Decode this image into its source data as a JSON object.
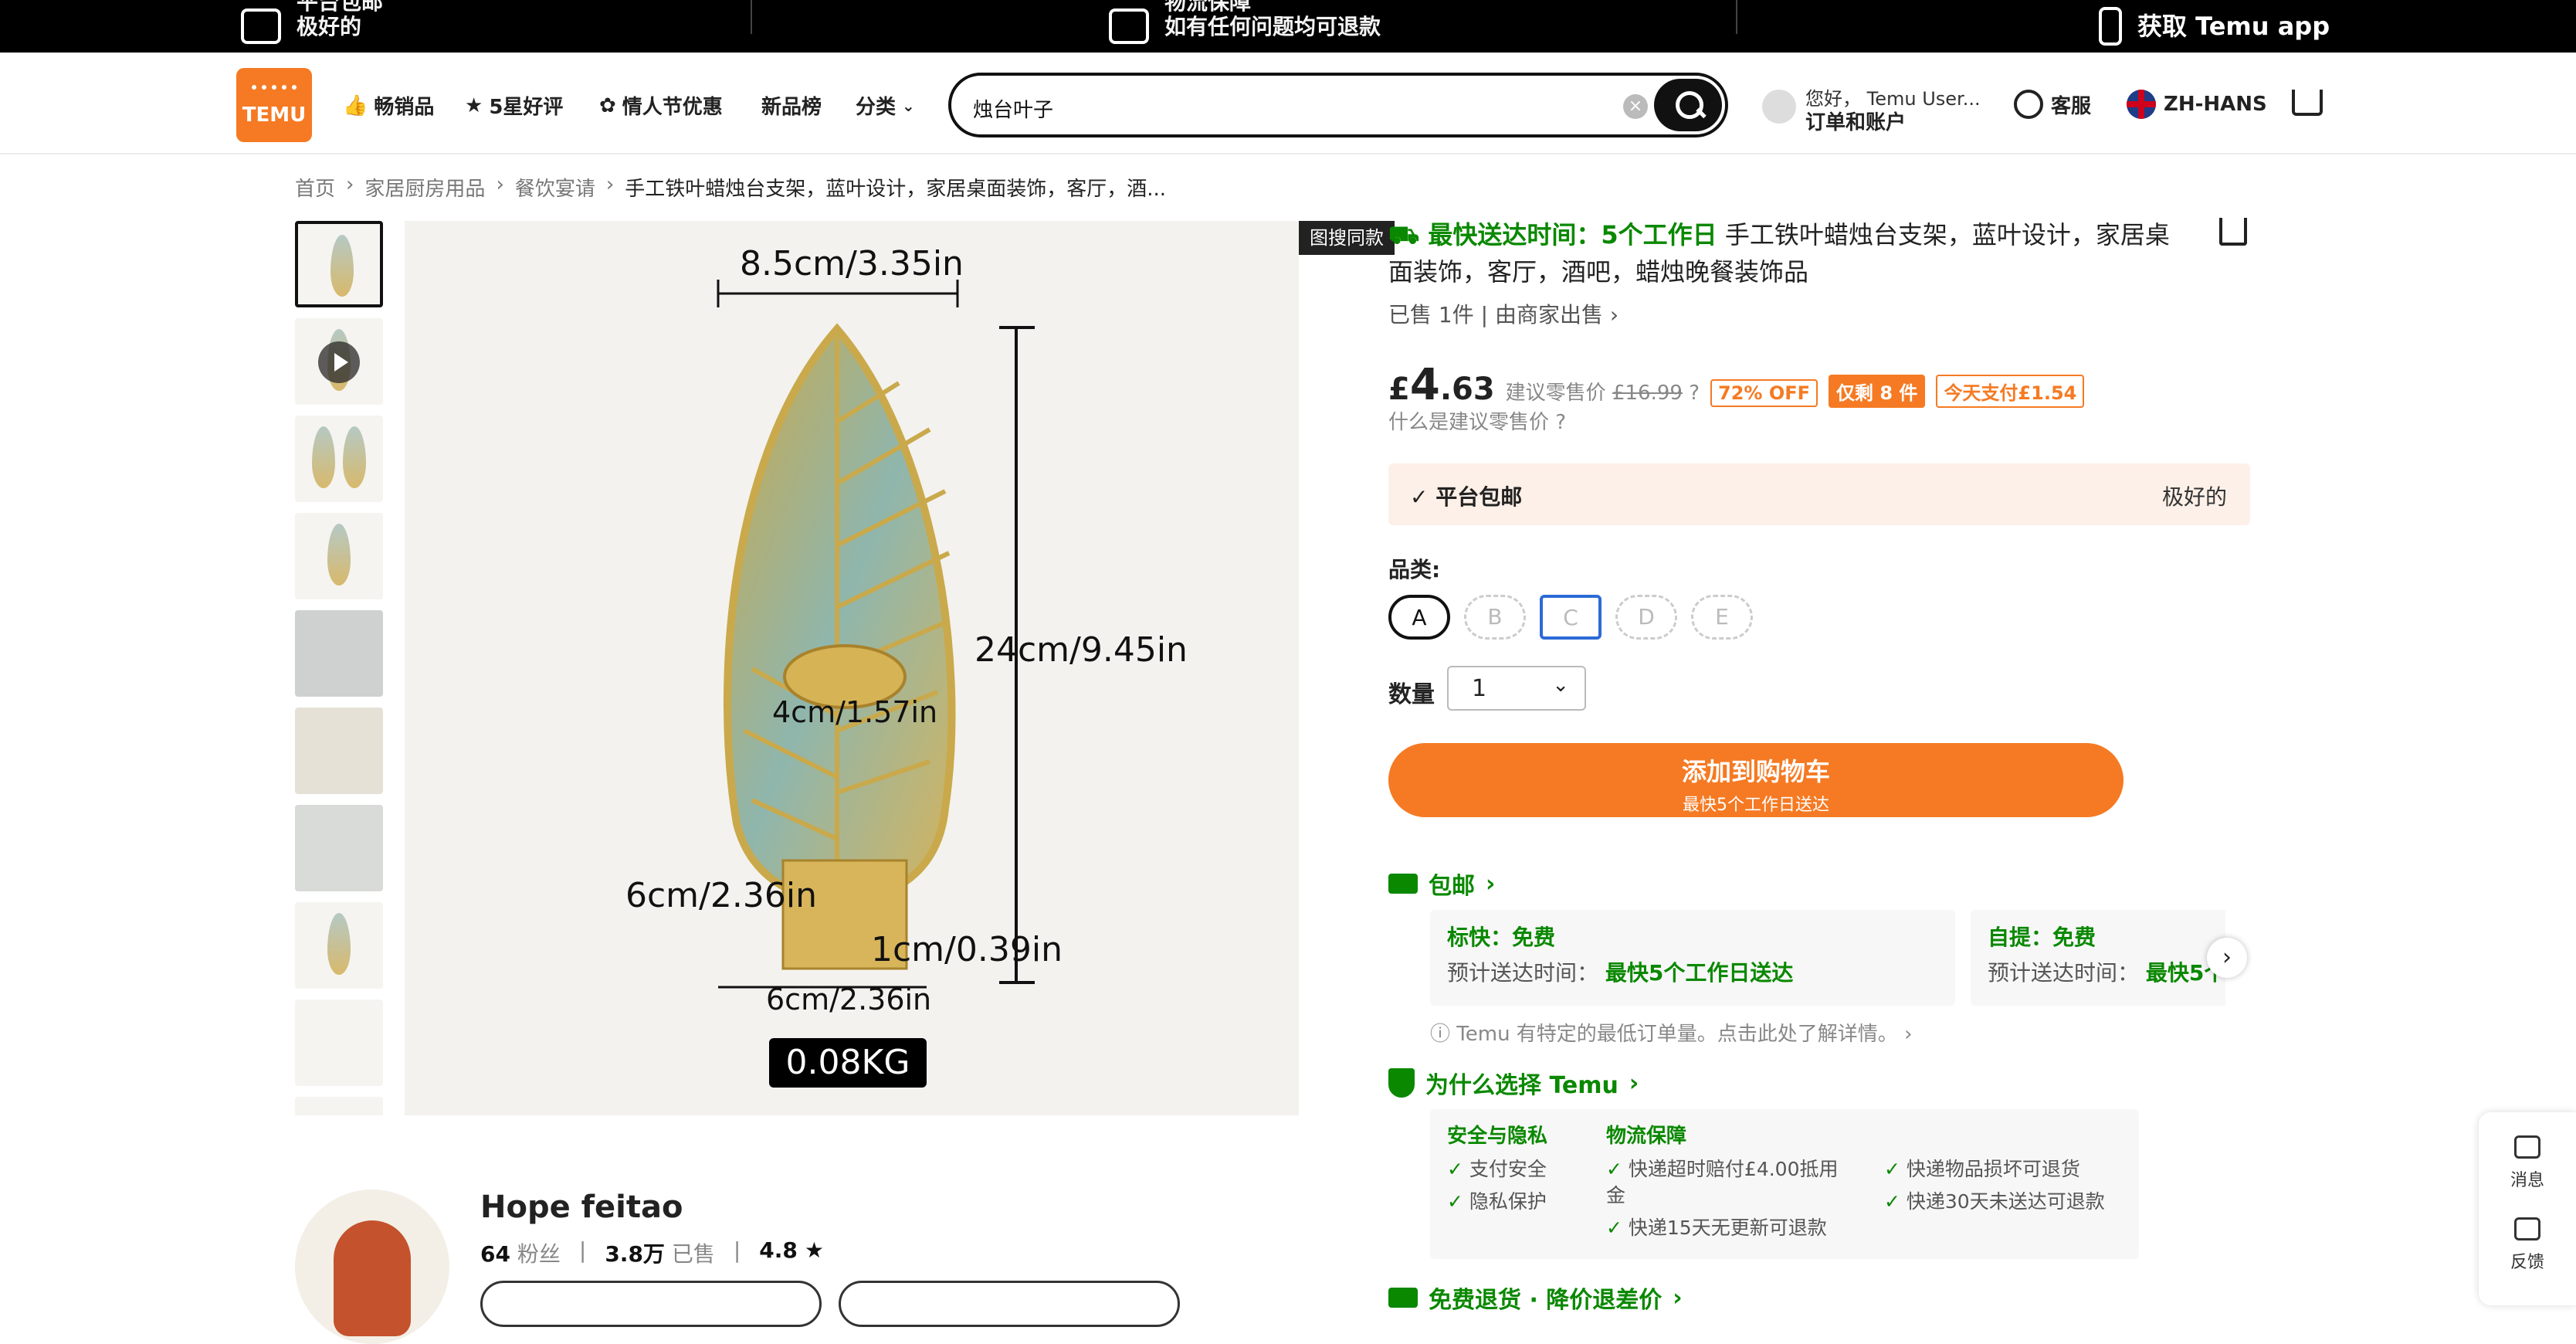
{
  "topbar": {
    "left_line1": "平台包邮",
    "left_line2": "极好的",
    "mid_line1": "物流保障",
    "mid_line2": "如有任何问题均可退款",
    "right_text": "获取 Temu app"
  },
  "header": {
    "logo_text": "TEMU",
    "nav": [
      "畅销品",
      "5星好评",
      "情人节优惠",
      "新品榜",
      "分类"
    ],
    "search_value": "烛台叶子",
    "account_line1": "您好， Temu User...",
    "account_line2": "订单和账户",
    "service": "客服",
    "language": "ZH-HANS"
  },
  "breadcrumbs": [
    "首页",
    "家居厨房用品",
    "餐饮宴请",
    "手工铁叶蜡烛台支架，蓝叶设计，家居桌面装饰，客厅，酒..."
  ],
  "gallery": {
    "tag": "图搜同款",
    "dims": {
      "width_top": "8.5cm/3.35in",
      "height": "24cm/9.45in",
      "cup": "4cm/1.57in",
      "base_depth": "6cm/2.36in",
      "base_height": "1cm/0.39in",
      "base_width": "6cm/2.36in",
      "weight": "0.08KG"
    }
  },
  "product": {
    "delivery_hl": "最快送达时间：5个工作日",
    "title": "手工铁叶蜡烛台支架，蓝叶设计，家居桌面装饰，客厅，酒吧，蜡烛晚餐装饰品",
    "sold": "已售 1件",
    "seller_link": "由商家出售",
    "price_currency": "£",
    "price_int": "4",
    "price_dec": ".63",
    "rrp_label": "建议零售价",
    "rrp_value": "£16.99",
    "badge_off": "72% OFF",
    "badge_left": "仅剩 8 件",
    "badge_pay": "今天支付£1.54",
    "what_rrp": "什么是建议零售价",
    "ship_left": "平台包邮",
    "ship_right": "极好的",
    "category_label": "品类:",
    "options": [
      "A",
      "B",
      "C",
      "D",
      "E"
    ],
    "qty_label": "数量",
    "qty_value": "1",
    "add_cart": "添加到购物车",
    "add_cart_sub": "最快5个工作日送达",
    "free_ship": "包邮",
    "card1_title": "标快：免费",
    "card1_label": "预计送达时间：",
    "card1_value": "最快5个工作日送达",
    "card2_title": "自提：免费",
    "card2_label": "预计送达时间：",
    "card2_value": "最快5个",
    "info_note": "Temu 有特定的最低订单量。点击此处了解详情。",
    "why_title": "为什么选择 Temu",
    "why_sec1": "安全与隐私",
    "why_sec2": "物流保障",
    "why_items1": [
      "支付安全",
      "隐私保护"
    ],
    "why_items2": [
      "快递超时赔付£4.00抵用",
      "金",
      "快递15天无更新可退款"
    ],
    "why_items3": [
      "快递物品损坏可退货",
      "快递30天未送达可退款"
    ],
    "returns": "免费退货 · 降价退差价"
  },
  "seller": {
    "name": "Hope feitao",
    "followers": "64",
    "followers_label": "粉丝",
    "sold": "3.8万",
    "sold_label": "已售",
    "rating": "4.8"
  },
  "floating": {
    "messages": "消息",
    "feedback": "反馈"
  }
}
